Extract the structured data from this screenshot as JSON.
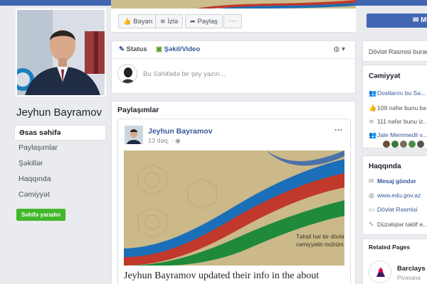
{
  "profile": {
    "name": "Jeyhun Bayramov"
  },
  "left_nav": {
    "items": [
      {
        "label": "Əsas səhifə",
        "active": true
      },
      {
        "label": "Paylaşımlar"
      },
      {
        "label": "Şəkillər"
      },
      {
        "label": "Haqqında"
      },
      {
        "label": "Cəmiyyət"
      }
    ],
    "create_page_label": "Səhifə yaradın"
  },
  "action_bar": {
    "like_label": "Bəyən",
    "follow_label": "İzlə",
    "share_label": "Paylaş",
    "more_label": "···"
  },
  "right_header": {
    "message_label": "M..."
  },
  "composer": {
    "tab_status": "Status",
    "tab_photo_video": "Şəkil/Video",
    "placeholder": "Bu Səhifədə bir şey yazın..."
  },
  "posts": {
    "section_title": "Paylaşımlar",
    "post": {
      "author": "Jeyhun Bayramov",
      "time": "13 dəq.",
      "image_caption_line1": "Təhsil hər bir dövlə",
      "image_caption_line2": "cəmiyyətin mühüm",
      "text": "Jeyhun Bayramov updated their info in the about"
    }
  },
  "right_col": {
    "category_text": "Dövlət Rəsmisi burada",
    "community": {
      "title": "Cəmiyyət",
      "invite": "Dostlarını bu Sə...",
      "likes": "109 nəfər bunu bə...",
      "follows": "111 nəfər bunu iz...",
      "friend": "Jale Memmedli v..."
    },
    "about": {
      "title": "Haqqında",
      "message": "Mesaj göndər",
      "website": "www.edu.gov.az",
      "category": "Dövlət Rəsmisi",
      "suggest": "Düzəlişlər təklif e..."
    },
    "related": {
      "title": "Related Pages",
      "page_name": "Barclays",
      "page_sub": "Pivəxana"
    }
  },
  "colors": {
    "brand_blue": "#4267b2",
    "link_blue": "#365899",
    "green_button": "#42b72a",
    "page_bg": "#e9ebee"
  }
}
